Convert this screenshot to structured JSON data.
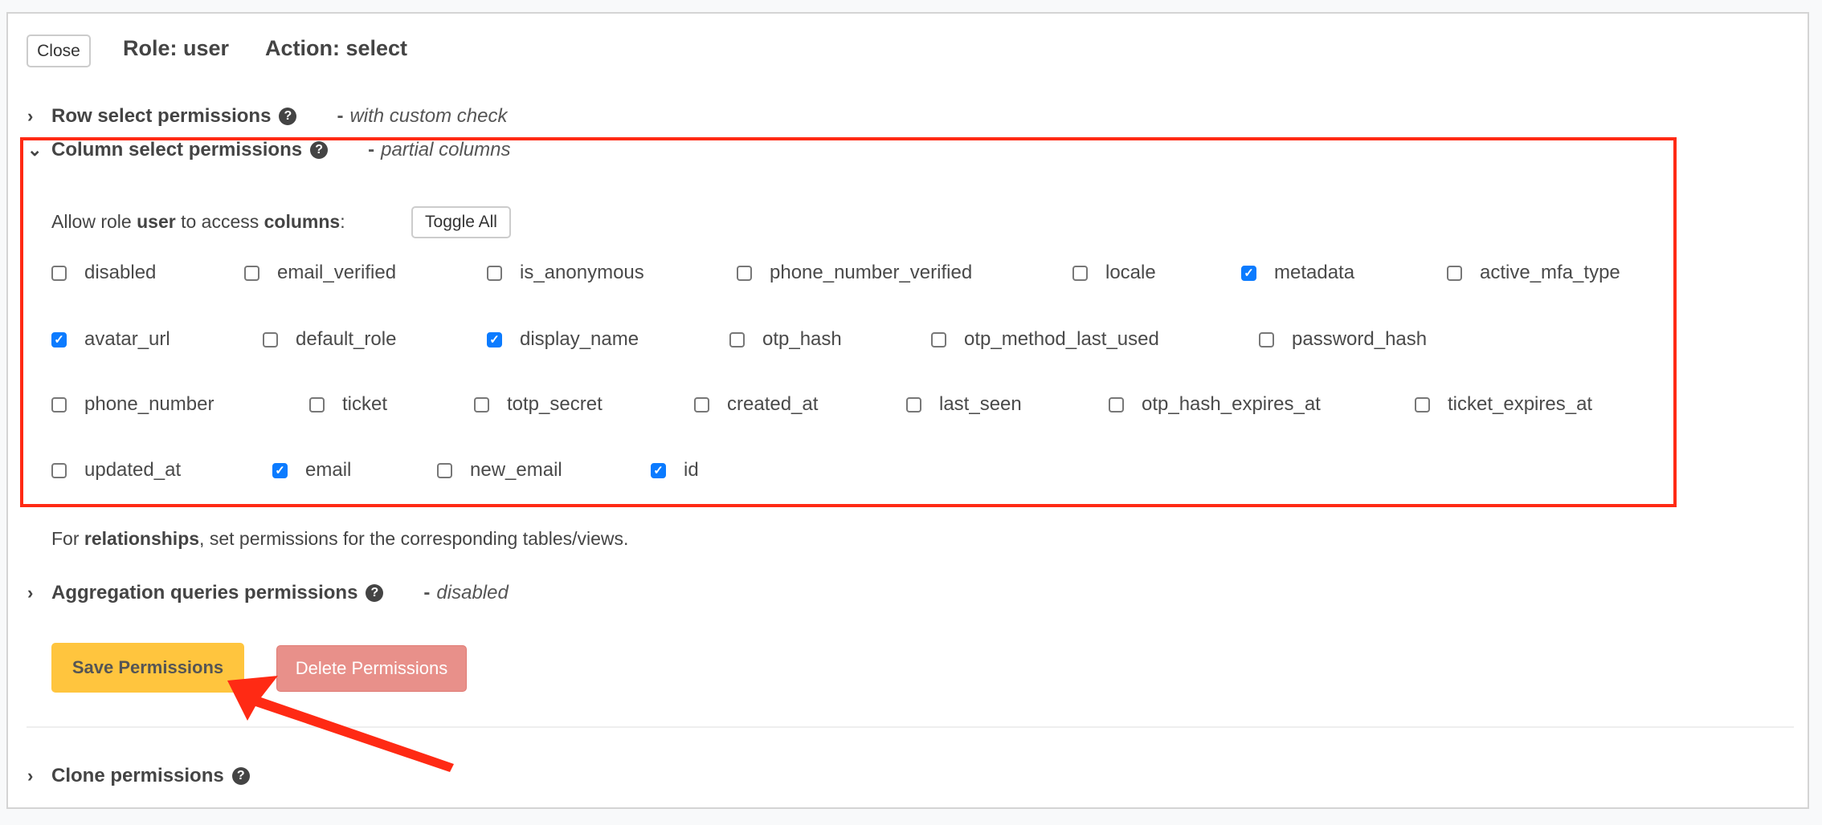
{
  "header": {
    "close_label": "Close",
    "role": "Role: user",
    "action": "Action: select"
  },
  "sections": {
    "row": {
      "label": "Row select permissions",
      "note": "with custom check"
    },
    "column": {
      "label": "Column select permissions",
      "note": "partial columns"
    },
    "aggregation": {
      "label": "Aggregation queries permissions",
      "note": "disabled"
    },
    "clone": {
      "label": "Clone permissions"
    }
  },
  "columns_intro": {
    "prefix": "Allow role ",
    "role": "user",
    "middle": " to access ",
    "word": "columns",
    "suffix": ":",
    "toggle_label": "Toggle All"
  },
  "columns": [
    [
      {
        "name": "disabled",
        "checked": false
      },
      {
        "name": "email_verified",
        "checked": false
      },
      {
        "name": "is_anonymous",
        "checked": false
      },
      {
        "name": "phone_number_verified",
        "checked": false
      },
      {
        "name": "locale",
        "checked": false
      },
      {
        "name": "metadata",
        "checked": true
      },
      {
        "name": "active_mfa_type",
        "checked": false
      }
    ],
    [
      {
        "name": "avatar_url",
        "checked": true
      },
      {
        "name": "default_role",
        "checked": false
      },
      {
        "name": "display_name",
        "checked": true
      },
      {
        "name": "otp_hash",
        "checked": false
      },
      {
        "name": "otp_method_last_used",
        "checked": false
      },
      {
        "name": "password_hash",
        "checked": false
      }
    ],
    [
      {
        "name": "phone_number",
        "checked": false
      },
      {
        "name": "ticket",
        "checked": false
      },
      {
        "name": "totp_secret",
        "checked": false
      },
      {
        "name": "created_at",
        "checked": false
      },
      {
        "name": "last_seen",
        "checked": false
      },
      {
        "name": "otp_hash_expires_at",
        "checked": false
      },
      {
        "name": "ticket_expires_at",
        "checked": false
      }
    ],
    [
      {
        "name": "updated_at",
        "checked": false
      },
      {
        "name": "email",
        "checked": true
      },
      {
        "name": "new_email",
        "checked": false
      },
      {
        "name": "id",
        "checked": true
      }
    ]
  ],
  "relationships": {
    "prefix": "For ",
    "word": "relationships",
    "suffix": ", set permissions for the corresponding tables/views."
  },
  "actions": {
    "save_label": "Save Permissions",
    "delete_label": "Delete Permissions"
  },
  "colors": {
    "annotation": "#ff2a14",
    "save": "#ffc53e",
    "delete": "#e8908a",
    "checkbox": "#0b7bff"
  }
}
